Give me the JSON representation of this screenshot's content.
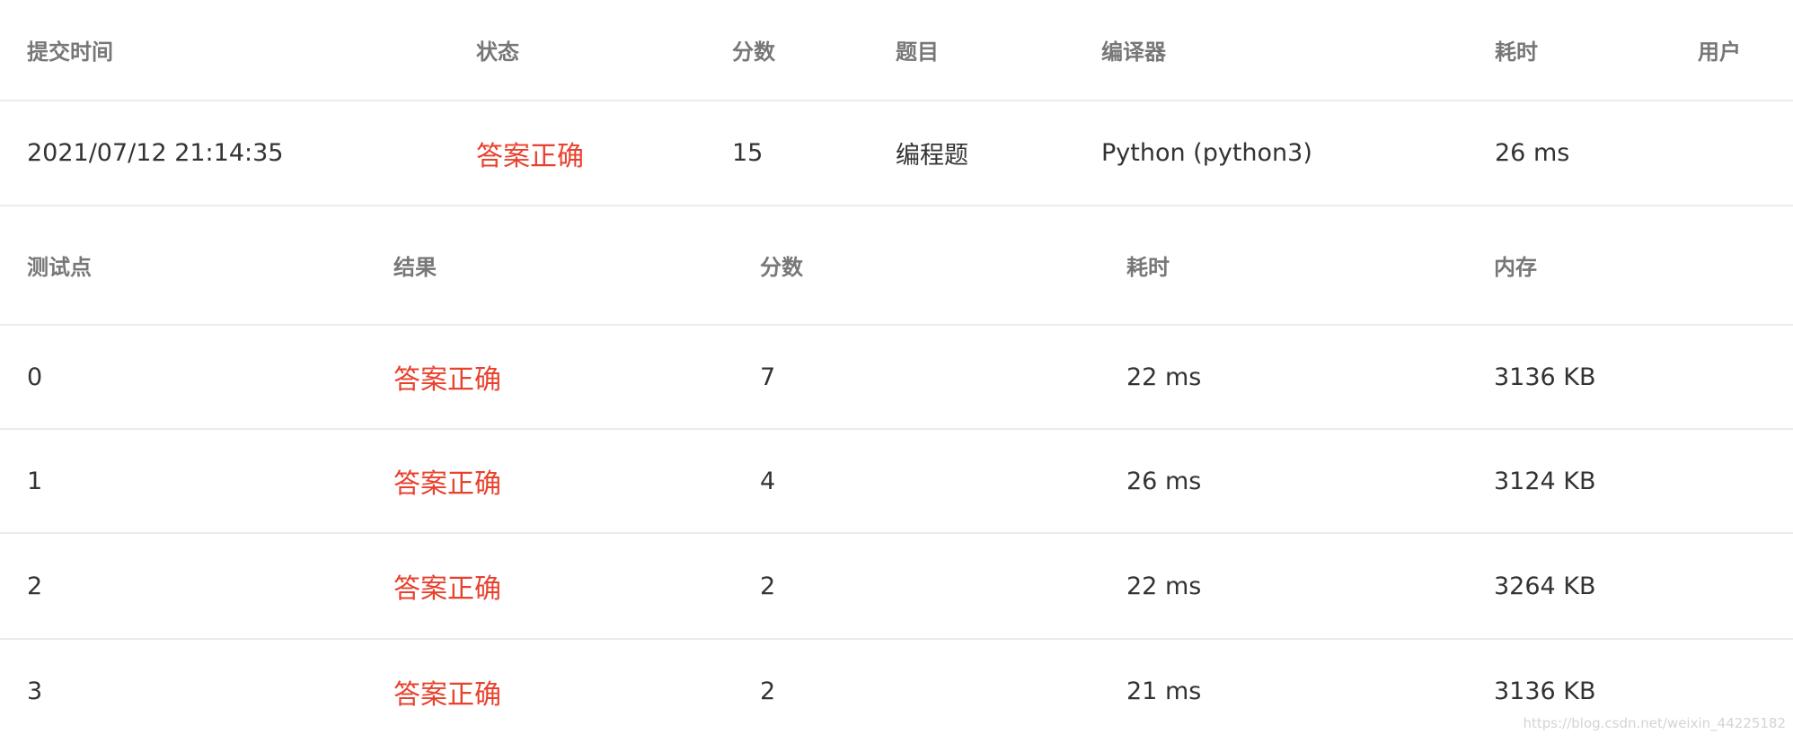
{
  "summary": {
    "headers": [
      "提交时间",
      "状态",
      "分数",
      "题目",
      "编译器",
      "耗时",
      "用户"
    ],
    "row": {
      "submit_time": "2021/07/12 21:14:35",
      "status": "答案正确",
      "score": "15",
      "problem": "编程题",
      "compiler": "Python (python3)",
      "time": "26 ms",
      "user": ""
    }
  },
  "cases": {
    "headers": [
      "测试点",
      "结果",
      "分数",
      "耗时",
      "内存"
    ],
    "rows": [
      {
        "id": "0",
        "result": "答案正确",
        "score": "7",
        "time": "22 ms",
        "memory": "3136 KB"
      },
      {
        "id": "1",
        "result": "答案正确",
        "score": "4",
        "time": "26 ms",
        "memory": "3124 KB"
      },
      {
        "id": "2",
        "result": "答案正确",
        "score": "2",
        "time": "22 ms",
        "memory": "3264 KB"
      },
      {
        "id": "3",
        "result": "答案正确",
        "score": "2",
        "time": "21 ms",
        "memory": "3136 KB"
      }
    ]
  },
  "watermark": "https://blog.csdn.net/weixin_44225182",
  "colors": {
    "accepted": "#e8412e",
    "header_text": "#777777",
    "body_text": "#333333",
    "row_border": "#ebebeb"
  }
}
